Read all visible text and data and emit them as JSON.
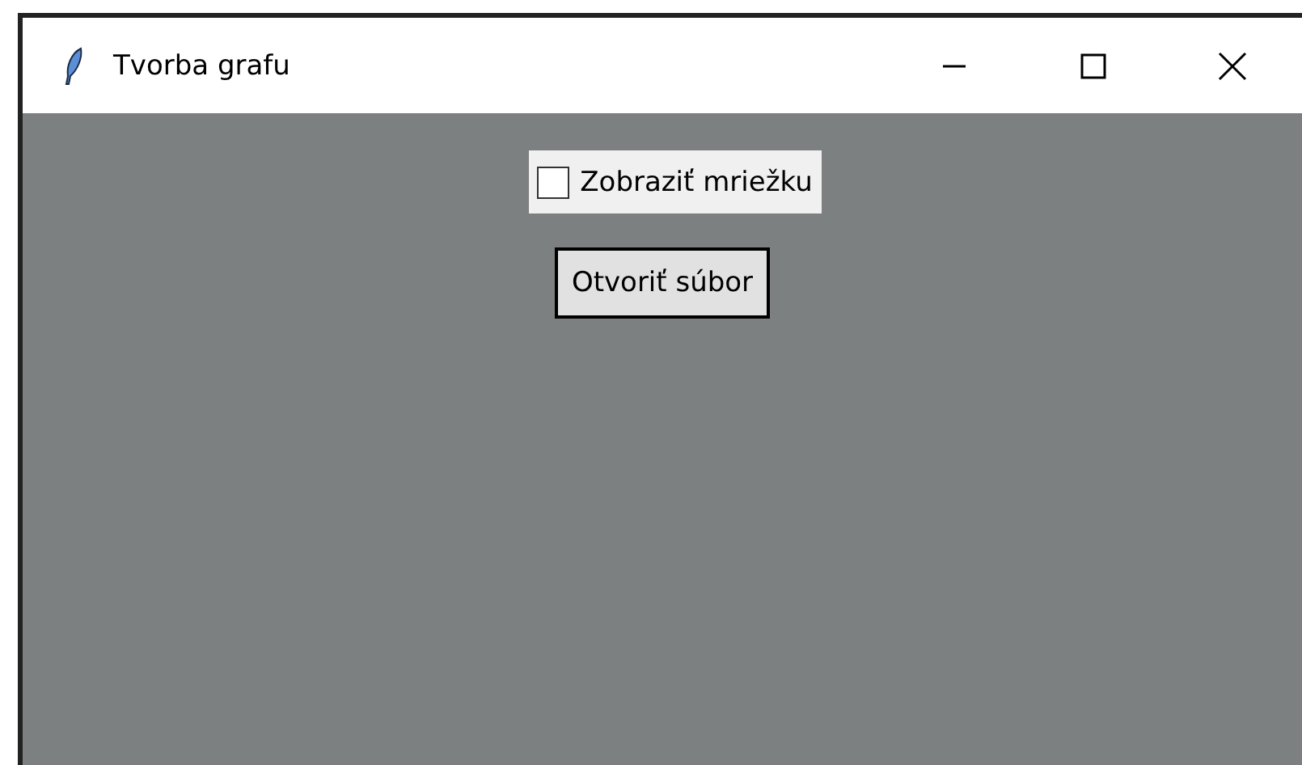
{
  "window": {
    "title": "Tvorba grafu"
  },
  "grid_checkbox": {
    "label": "Zobraziť mriežku",
    "checked": false
  },
  "buttons": [
    "Otvoriť súbor"
  ]
}
